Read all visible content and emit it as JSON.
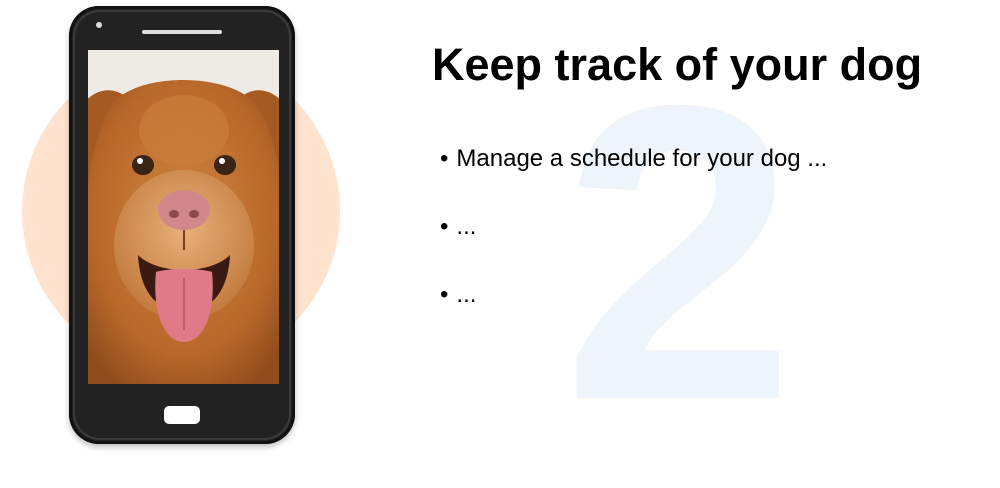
{
  "slide": {
    "title": "Keep track of your dog",
    "number": "2",
    "bullets": [
      {
        "marker": "•",
        "text": "Manage a schedule for your dog ..."
      },
      {
        "marker": "•",
        "text": "..."
      },
      {
        "marker": "•",
        "text": "..."
      }
    ]
  },
  "colors": {
    "blob": "#ffe3cf",
    "phone_body": "#222222",
    "number": "#edf4fc",
    "dog_fur": "#b8682a"
  },
  "icons": {
    "phone": "smartphone-illustration",
    "photo": "dog-photo"
  }
}
